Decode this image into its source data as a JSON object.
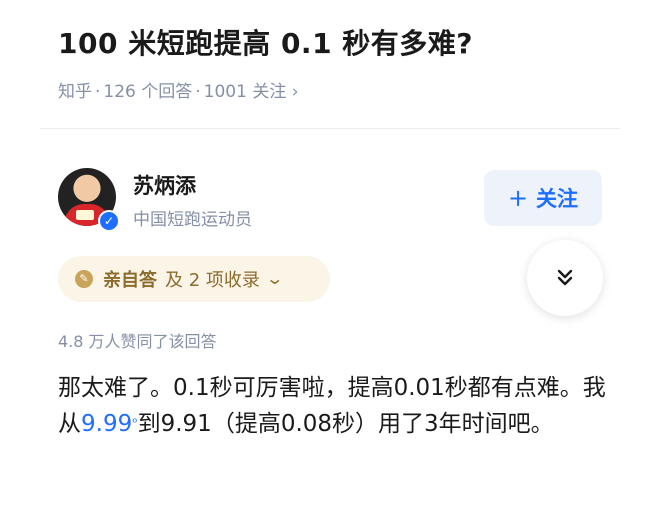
{
  "question": {
    "title": "100 米短跑提高 0.1 秒有多难?",
    "source": "知乎",
    "answer_count": "126 个回答",
    "follow_count": "1001 关注",
    "meta_chevron": "›"
  },
  "author": {
    "name": "苏炳添",
    "headline": "中国短跑运动员",
    "verified_mark": "✓"
  },
  "follow_button": {
    "icon": "plus-icon",
    "plus": "+",
    "label": "关注"
  },
  "badge": {
    "icon": "self-answer-badge-icon",
    "main_label": "亲自答",
    "extra_label": "及 2 项收录",
    "chevron": "⌄"
  },
  "collapse_button": {
    "icon": "double-chevron-down-icon"
  },
  "votes": {
    "text": "4.8 万人赞同了该回答"
  },
  "answer": {
    "part1": "那太难了。0.1秒可厉害啦，提高0.01秒都有点难。我从",
    "link_text": "9.99",
    "link_mark": "ᵒ",
    "part2": "到9.91（提高0.08秒）用了3年时间吧。"
  },
  "colors": {
    "accent": "#1e6fff",
    "meta_gray": "#8590a6",
    "badge_bg": "#fbf5e8",
    "badge_text": "#8c6b2c"
  }
}
